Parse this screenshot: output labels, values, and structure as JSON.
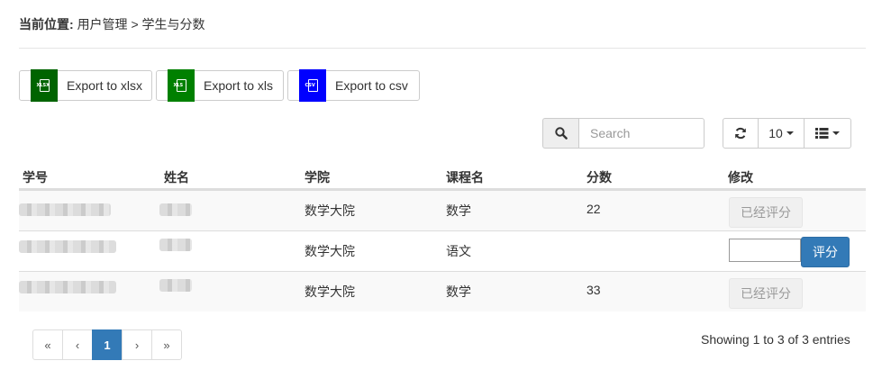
{
  "breadcrumb": {
    "prefix": "当前位置:",
    "path": "用户管理 > 学生与分数"
  },
  "exports": [
    {
      "label": "Export to xlsx",
      "icon": "xlsx-file-icon",
      "icon_text": "XLSX",
      "color": "#006400"
    },
    {
      "label": "Export to xls",
      "icon": "xls-file-icon",
      "icon_text": "XLS",
      "color": "#008000"
    },
    {
      "label": "Export to csv",
      "icon": "csv-file-icon",
      "icon_text": "CSV",
      "color": "#0000ff"
    }
  ],
  "search": {
    "placeholder": "Search",
    "icon": "search-icon"
  },
  "toolbar": {
    "refresh_icon": "refresh-icon",
    "page_size": "10",
    "columns_icon": "list-columns-icon"
  },
  "table": {
    "headers": [
      "学号",
      "姓名",
      "学院",
      "课程名",
      "分数",
      "修改"
    ],
    "rows": [
      {
        "college": "数学大院",
        "course": "数学",
        "score": "22",
        "action": "已经评分",
        "state": "graded"
      },
      {
        "college": "数学大院",
        "course": "语文",
        "score": "",
        "action": "评分",
        "state": "input"
      },
      {
        "college": "数学大院",
        "course": "数学",
        "score": "33",
        "action": "已经评分",
        "state": "graded"
      }
    ]
  },
  "pagination": {
    "first": "«",
    "prev": "‹",
    "current": "1",
    "next": "›",
    "last": "»"
  },
  "summary": "Showing 1 to 3 of 3 entries",
  "colors": {
    "primary": "#337ab7",
    "stripe": "#f9f9f9",
    "border": "#dddddd"
  }
}
